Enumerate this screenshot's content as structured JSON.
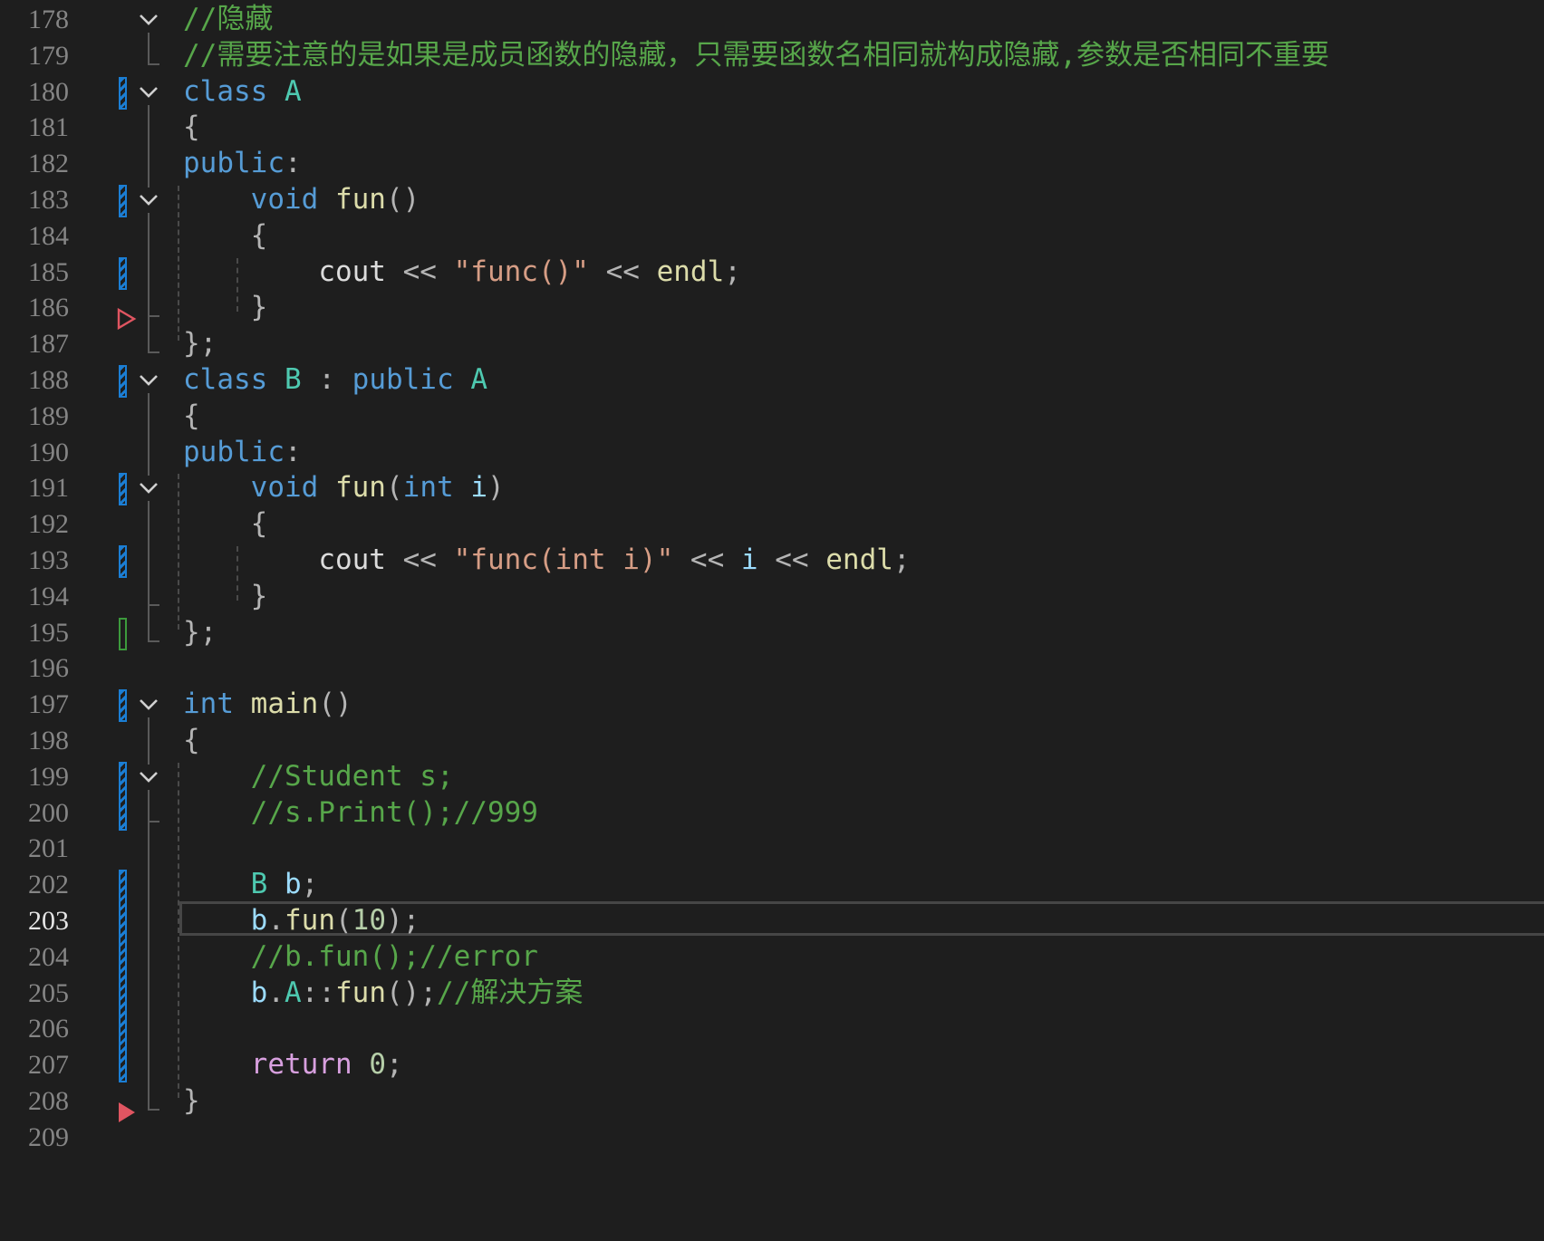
{
  "editor": {
    "current_line": 203,
    "lines": [
      {
        "number": "178",
        "tokens": [
          {
            "t": "//隐藏",
            "c": "comment"
          }
        ]
      },
      {
        "number": "179",
        "tokens": [
          {
            "t": "//需要注意的是如果是成员函数的隐藏，只需要函数名相同就构成隐藏,参数是否相同不重要",
            "c": "comment"
          }
        ]
      },
      {
        "number": "180",
        "tokens": [
          {
            "t": "class ",
            "c": "kw"
          },
          {
            "t": "A",
            "c": "type"
          }
        ]
      },
      {
        "number": "181",
        "tokens": [
          {
            "t": "{",
            "c": "punct"
          }
        ]
      },
      {
        "number": "182",
        "tokens": [
          {
            "t": "public",
            "c": "kw"
          },
          {
            "t": ":",
            "c": "punct"
          }
        ]
      },
      {
        "number": "183",
        "tokens": [
          {
            "t": "    ",
            "c": "plain"
          },
          {
            "t": "void ",
            "c": "kw"
          },
          {
            "t": "fun",
            "c": "fn"
          },
          {
            "t": "()",
            "c": "punct"
          }
        ]
      },
      {
        "number": "184",
        "tokens": [
          {
            "t": "    ",
            "c": "plain"
          },
          {
            "t": "{",
            "c": "punct"
          }
        ]
      },
      {
        "number": "185",
        "tokens": [
          {
            "t": "        ",
            "c": "plain"
          },
          {
            "t": "cout",
            "c": "plain"
          },
          {
            "t": " << ",
            "c": "punct"
          },
          {
            "t": "\"func()\"",
            "c": "str"
          },
          {
            "t": " << ",
            "c": "punct"
          },
          {
            "t": "endl",
            "c": "fn"
          },
          {
            "t": ";",
            "c": "punct"
          }
        ]
      },
      {
        "number": "186",
        "tokens": [
          {
            "t": "    ",
            "c": "plain"
          },
          {
            "t": "}",
            "c": "punct"
          }
        ]
      },
      {
        "number": "187",
        "tokens": [
          {
            "t": "};",
            "c": "punct"
          }
        ]
      },
      {
        "number": "188",
        "tokens": [
          {
            "t": "class ",
            "c": "kw"
          },
          {
            "t": "B",
            "c": "type"
          },
          {
            "t": " : ",
            "c": "punct"
          },
          {
            "t": "public ",
            "c": "kw"
          },
          {
            "t": "A",
            "c": "type"
          }
        ]
      },
      {
        "number": "189",
        "tokens": [
          {
            "t": "{",
            "c": "punct"
          }
        ]
      },
      {
        "number": "190",
        "tokens": [
          {
            "t": "public",
            "c": "kw"
          },
          {
            "t": ":",
            "c": "punct"
          }
        ]
      },
      {
        "number": "191",
        "tokens": [
          {
            "t": "    ",
            "c": "plain"
          },
          {
            "t": "void ",
            "c": "kw"
          },
          {
            "t": "fun",
            "c": "fn"
          },
          {
            "t": "(",
            "c": "punct"
          },
          {
            "t": "int ",
            "c": "kw"
          },
          {
            "t": "i",
            "c": "var"
          },
          {
            "t": ")",
            "c": "punct"
          }
        ]
      },
      {
        "number": "192",
        "tokens": [
          {
            "t": "    ",
            "c": "plain"
          },
          {
            "t": "{",
            "c": "punct"
          }
        ]
      },
      {
        "number": "193",
        "tokens": [
          {
            "t": "        ",
            "c": "plain"
          },
          {
            "t": "cout",
            "c": "plain"
          },
          {
            "t": " << ",
            "c": "punct"
          },
          {
            "t": "\"func(int i)\"",
            "c": "str"
          },
          {
            "t": " << ",
            "c": "punct"
          },
          {
            "t": "i",
            "c": "var"
          },
          {
            "t": " << ",
            "c": "punct"
          },
          {
            "t": "endl",
            "c": "fn"
          },
          {
            "t": ";",
            "c": "punct"
          }
        ]
      },
      {
        "number": "194",
        "tokens": [
          {
            "t": "    ",
            "c": "plain"
          },
          {
            "t": "}",
            "c": "punct"
          }
        ]
      },
      {
        "number": "195",
        "tokens": [
          {
            "t": "};",
            "c": "punct"
          }
        ]
      },
      {
        "number": "196",
        "tokens": []
      },
      {
        "number": "197",
        "tokens": [
          {
            "t": "int ",
            "c": "kw"
          },
          {
            "t": "main",
            "c": "fn"
          },
          {
            "t": "()",
            "c": "punct"
          }
        ]
      },
      {
        "number": "198",
        "tokens": [
          {
            "t": "{",
            "c": "punct"
          }
        ]
      },
      {
        "number": "199",
        "tokens": [
          {
            "t": "    ",
            "c": "plain"
          },
          {
            "t": "//Student s;",
            "c": "comment"
          }
        ]
      },
      {
        "number": "200",
        "tokens": [
          {
            "t": "    ",
            "c": "plain"
          },
          {
            "t": "//s.Print();//999",
            "c": "comment"
          }
        ]
      },
      {
        "number": "201",
        "tokens": []
      },
      {
        "number": "202",
        "tokens": [
          {
            "t": "    ",
            "c": "plain"
          },
          {
            "t": "B",
            "c": "type"
          },
          {
            "t": " ",
            "c": "plain"
          },
          {
            "t": "b",
            "c": "var"
          },
          {
            "t": ";",
            "c": "punct"
          }
        ]
      },
      {
        "number": "203",
        "tokens": [
          {
            "t": "    ",
            "c": "plain"
          },
          {
            "t": "b",
            "c": "var"
          },
          {
            "t": ".",
            "c": "punct"
          },
          {
            "t": "fun",
            "c": "fn"
          },
          {
            "t": "(",
            "c": "punct"
          },
          {
            "t": "10",
            "c": "num"
          },
          {
            "t": ");",
            "c": "punct"
          }
        ]
      },
      {
        "number": "204",
        "tokens": [
          {
            "t": "    ",
            "c": "plain"
          },
          {
            "t": "//b.fun();//error",
            "c": "comment"
          }
        ]
      },
      {
        "number": "205",
        "tokens": [
          {
            "t": "    ",
            "c": "plain"
          },
          {
            "t": "b",
            "c": "var"
          },
          {
            "t": ".",
            "c": "punct"
          },
          {
            "t": "A",
            "c": "type"
          },
          {
            "t": "::",
            "c": "punct"
          },
          {
            "t": "fun",
            "c": "fn"
          },
          {
            "t": "();",
            "c": "punct"
          },
          {
            "t": "//解决方案",
            "c": "comment"
          }
        ]
      },
      {
        "number": "206",
        "tokens": []
      },
      {
        "number": "207",
        "tokens": [
          {
            "t": "    ",
            "c": "plain"
          },
          {
            "t": "return ",
            "c": "ctrl"
          },
          {
            "t": "0",
            "c": "num"
          },
          {
            "t": ";",
            "c": "punct"
          }
        ]
      },
      {
        "number": "208",
        "tokens": [
          {
            "t": "}",
            "c": "punct"
          }
        ]
      },
      {
        "number": "209",
        "tokens": []
      }
    ]
  },
  "gutter": {
    "change_bars": [
      {
        "from": 180,
        "to": 180,
        "kind": "modified"
      },
      {
        "from": 183,
        "to": 183,
        "kind": "modified"
      },
      {
        "from": 185,
        "to": 185,
        "kind": "modified"
      },
      {
        "from": 188,
        "to": 188,
        "kind": "modified"
      },
      {
        "from": 191,
        "to": 191,
        "kind": "modified"
      },
      {
        "from": 193,
        "to": 193,
        "kind": "modified"
      },
      {
        "from": 195,
        "to": 195,
        "kind": "saved"
      },
      {
        "from": 197,
        "to": 197,
        "kind": "modified"
      },
      {
        "from": 199,
        "to": 200,
        "kind": "modified"
      },
      {
        "from": 202,
        "to": 207,
        "kind": "modified"
      }
    ],
    "fold_toggles": [
      178,
      180,
      183,
      188,
      191,
      197,
      199
    ],
    "fold_blocks": [
      {
        "from": 178,
        "to": 179
      },
      {
        "from": 180,
        "to": 187
      },
      {
        "from": 183,
        "to": 186
      },
      {
        "from": 188,
        "to": 195
      },
      {
        "from": 191,
        "to": 194
      },
      {
        "from": 197,
        "to": 208
      },
      {
        "from": 199,
        "to": 200
      }
    ],
    "breakpoint_markers": [
      {
        "line": 186,
        "style": "outline"
      },
      {
        "line": 208,
        "style": "filled"
      }
    ],
    "colors": {
      "modified": "#1b7ed4",
      "saved": "#3c9a3c",
      "marker": "#e05561"
    }
  }
}
